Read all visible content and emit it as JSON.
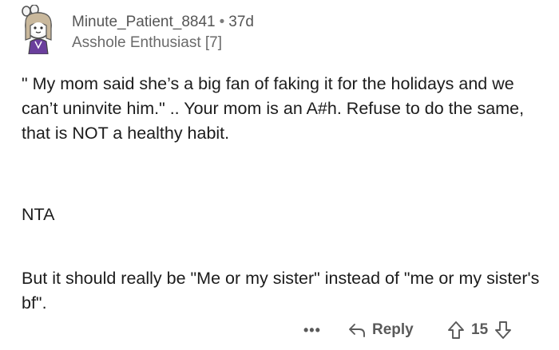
{
  "comment": {
    "username": "Minute_Patient_8841",
    "separator": "•",
    "age": "37d",
    "flair": "Asshole Enthusiast [7]",
    "paragraphs": [
      "\" My mom said she’s a big fan of faking it for the holidays and we can’t uninvite him.\" .. Your mom is an A#h. Refuse to do the same, that is NOT a healthy habit.",
      "NTA",
      "But it should really be \"Me or my sister\" instead of \"me or my sister's bf\"."
    ]
  },
  "actions": {
    "more_label": "•••",
    "reply_label": "Reply",
    "vote_count": "15"
  },
  "icons": {
    "avatar": "snoo-avatar-icon",
    "reply": "reply-arrow-icon",
    "upvote": "upvote-arrow-icon",
    "downvote": "downvote-arrow-icon"
  },
  "colors": {
    "text": "#1c1c1c",
    "meta": "#6a6a6a",
    "avatar_accent": "#6a3e9c"
  }
}
